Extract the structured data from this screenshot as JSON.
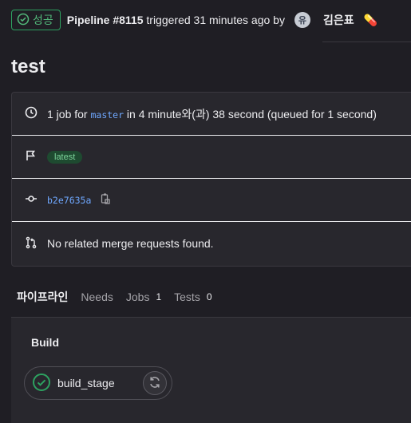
{
  "header": {
    "status": "성공",
    "pipeline_label": "Pipeline #8115",
    "triggered_text": " triggered 31 minutes ago by ",
    "avatar_initials": "유",
    "username": "김은표",
    "emoji": "💊"
  },
  "page_title": "test",
  "info": {
    "job_prefix": "1 job for ",
    "branch": "master",
    "job_suffix": " in 4 minute와(과) 38 second (queued for 1 second)",
    "badge": "latest",
    "commit_sha": "b2e7635a",
    "merge_text": "No related merge requests found."
  },
  "tabs": [
    {
      "label": "파이프라인",
      "count": ""
    },
    {
      "label": "Needs",
      "count": ""
    },
    {
      "label": "Jobs",
      "count": "1"
    },
    {
      "label": "Tests",
      "count": "0"
    }
  ],
  "stage": {
    "title": "Build",
    "job_name": "build_stage"
  }
}
